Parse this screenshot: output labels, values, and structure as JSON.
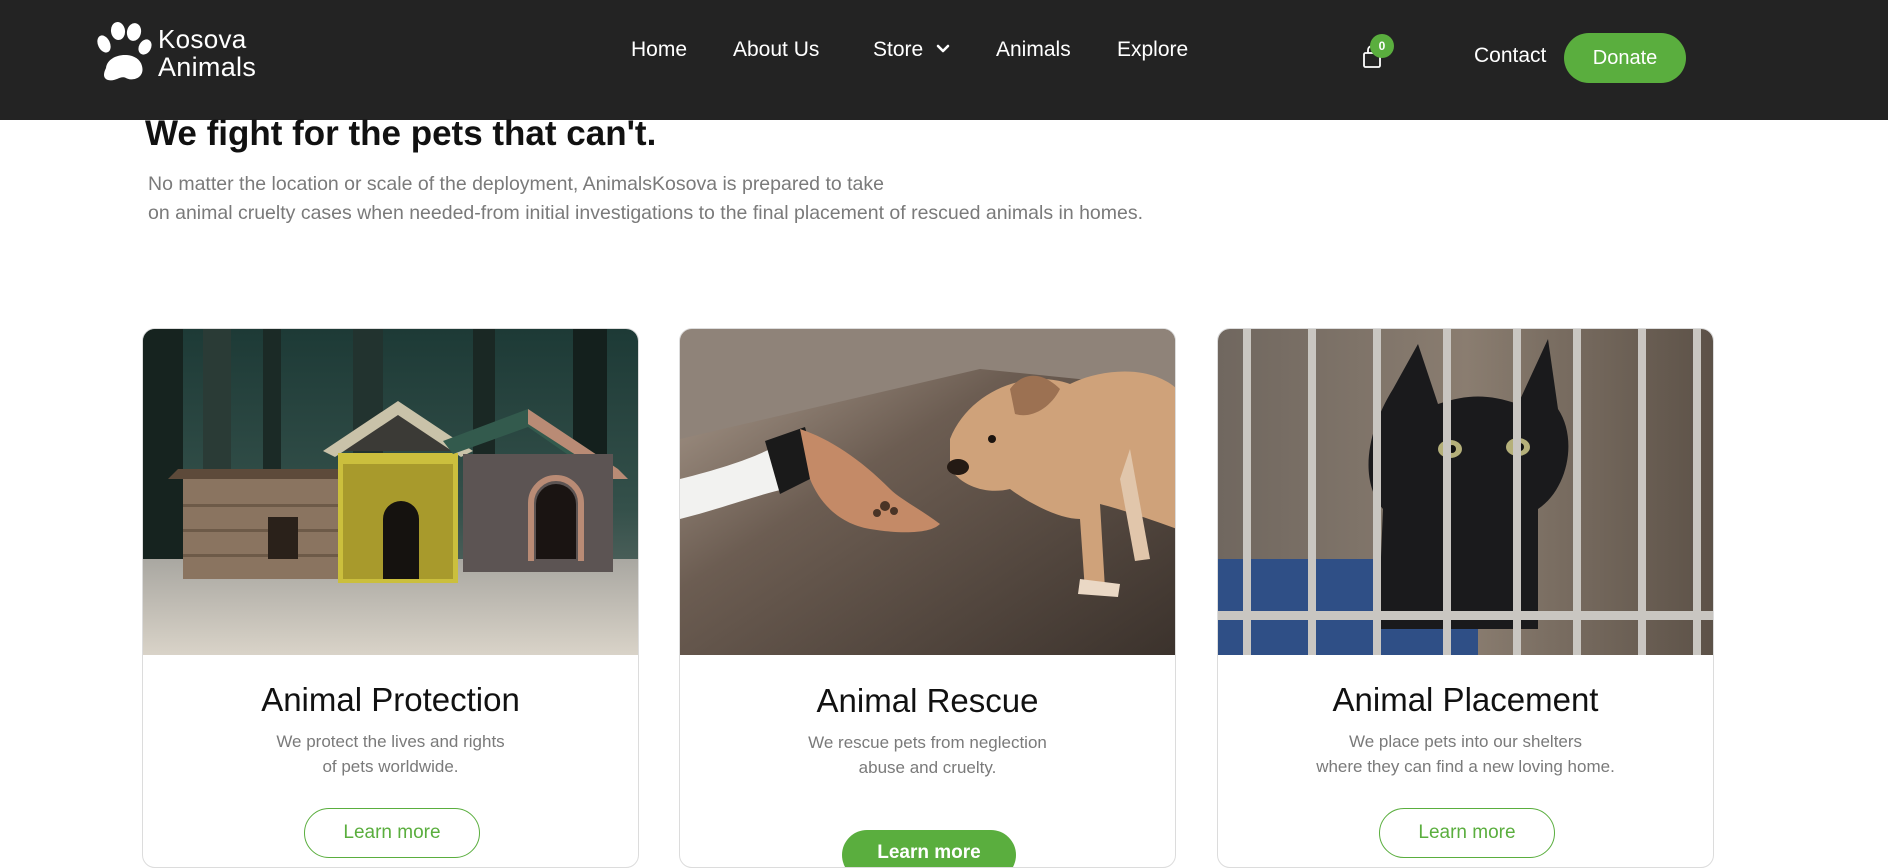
{
  "header": {
    "logo_line1": "Kosova",
    "logo_line2": "Animals",
    "nav": [
      {
        "label": "Home"
      },
      {
        "label": "About  Us"
      },
      {
        "label": "Store"
      },
      {
        "label": "Animals"
      },
      {
        "label": "Explore"
      }
    ],
    "cart_count": "0",
    "contact_label": "Contact",
    "donate_label": "Donate"
  },
  "hero": {
    "title": "We fight for the pets that can't.",
    "intro_line1": "No matter the location or scale of the deployment, AnimalsKosova is prepared to take",
    "intro_line2": "on animal cruelty cases when needed-from initial investigations to the final placement of rescued animals in homes."
  },
  "cards": [
    {
      "title": "Animal Protection",
      "desc_line1": "We protect the lives and rights",
      "desc_line2": "of pets worldwide.",
      "button": "Learn more"
    },
    {
      "title": "Animal Rescue",
      "desc_line1": "We rescue pets from neglection",
      "desc_line2": "abuse and cruelty.",
      "button": "Learn more"
    },
    {
      "title": "Animal Placement",
      "desc_line1": "We place pets into our shelters",
      "desc_line2": "where they can find a new loving home.",
      "button": "Learn more"
    }
  ],
  "colors": {
    "header_bg": "#232323",
    "accent": "#5aae3e",
    "body_text": "#7a7a7a"
  },
  "icons": {
    "logo": "paw-print-icon",
    "store_dropdown": "chevron-down-icon",
    "cart": "shopping-bag-icon"
  }
}
